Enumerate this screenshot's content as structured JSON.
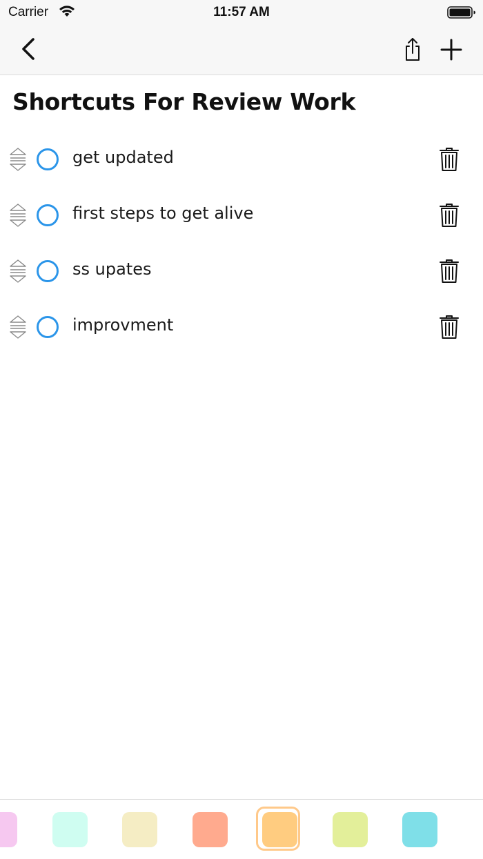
{
  "status_bar": {
    "carrier": "Carrier",
    "time": "11:57 AM"
  },
  "nav": {
    "back_icon": "chevron-left-icon",
    "share_icon": "share-icon",
    "add_icon": "plus-icon"
  },
  "page": {
    "title": "Shortcuts For Review Work"
  },
  "tasks": [
    {
      "label": "get updated"
    },
    {
      "label": "first steps to get alive"
    },
    {
      "label": "ss upates"
    },
    {
      "label": "improvment"
    }
  ],
  "colors": {
    "accent": "#2b95e9",
    "palette": [
      "#f6c8f0",
      "#cffdf1",
      "#f5edc4",
      "#ffaa8e",
      "#ffcc80",
      "#e3ef9a",
      "#7fdfe8"
    ],
    "selected_swatch_index": 4
  }
}
